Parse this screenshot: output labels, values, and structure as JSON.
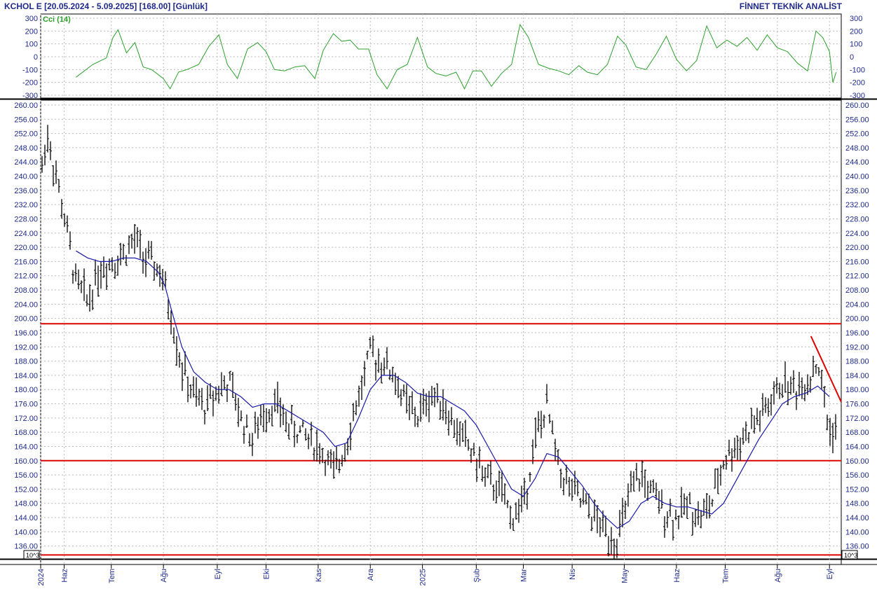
{
  "header": {
    "instrument": "KCHOL E",
    "range": "[20.05.2024 - 5.09.2025]",
    "last": "[168.00]",
    "period": "[Günlük]",
    "brand": "FİNNET TEKNİK ANALİST"
  },
  "colors": {
    "price_bars": "#000000",
    "moving_average": "#1a1aa8",
    "cci_line": "#2ca02c",
    "support_resistance": "#dd0000",
    "axis_text": "#1f2a8a",
    "grid": "#bbbbbb"
  },
  "chart_data": [
    {
      "type": "line",
      "title": "Cci (14)",
      "ylim": [
        -300,
        300
      ],
      "yticks": [
        300,
        200,
        100,
        0,
        -100,
        -200,
        -300
      ],
      "x_dates": [
        "2024-06-10",
        "2024-06-20",
        "2024-06-28",
        "2024-07-02",
        "2024-07-05",
        "2024-07-10",
        "2024-07-15",
        "2024-07-20",
        "2024-07-25",
        "2024-08-01",
        "2024-08-05",
        "2024-08-10",
        "2024-08-15",
        "2024-08-22",
        "2024-08-28",
        "2024-09-03",
        "2024-09-08",
        "2024-09-14",
        "2024-09-20",
        "2024-09-26",
        "2024-10-01",
        "2024-10-06",
        "2024-10-12",
        "2024-10-18",
        "2024-10-24",
        "2024-10-30",
        "2024-11-04",
        "2024-11-10",
        "2024-11-15",
        "2024-11-20",
        "2024-11-25",
        "2024-12-01",
        "2024-12-06",
        "2024-12-12",
        "2024-12-18",
        "2024-12-24",
        "2024-12-30",
        "2025-01-05",
        "2025-01-10",
        "2025-01-16",
        "2025-01-22",
        "2025-01-27",
        "2025-02-01",
        "2025-02-06",
        "2025-02-12",
        "2025-02-18",
        "2025-02-24",
        "2025-03-01",
        "2025-03-06",
        "2025-03-12",
        "2025-03-18",
        "2025-03-24",
        "2025-03-30",
        "2025-04-05",
        "2025-04-10",
        "2025-04-16",
        "2025-04-22",
        "2025-04-28",
        "2025-05-03",
        "2025-05-09",
        "2025-05-15",
        "2025-05-21",
        "2025-05-27",
        "2025-06-02",
        "2025-06-08",
        "2025-06-14",
        "2025-06-20",
        "2025-06-26",
        "2025-07-02",
        "2025-07-08",
        "2025-07-14",
        "2025-07-20",
        "2025-07-26",
        "2025-08-01",
        "2025-08-07",
        "2025-08-13",
        "2025-08-19",
        "2025-08-24",
        "2025-08-28",
        "2025-09-01",
        "2025-09-03",
        "2025-09-05"
      ],
      "values": [
        -160,
        -60,
        -10,
        150,
        210,
        30,
        110,
        -80,
        -100,
        -170,
        -250,
        -120,
        -100,
        -60,
        80,
        170,
        -60,
        -170,
        60,
        110,
        40,
        -100,
        -110,
        -80,
        -70,
        -170,
        50,
        180,
        120,
        130,
        60,
        60,
        -140,
        -250,
        -100,
        -60,
        150,
        -80,
        -130,
        -150,
        -120,
        -250,
        -110,
        -110,
        -230,
        -130,
        -60,
        250,
        150,
        -60,
        -90,
        -110,
        -140,
        -70,
        -120,
        -140,
        -60,
        160,
        90,
        -80,
        -100,
        20,
        160,
        -20,
        -110,
        -30,
        240,
        70,
        130,
        80,
        150,
        50,
        170,
        70,
        40,
        -50,
        -110,
        200,
        150,
        40,
        -200,
        -120
      ]
    },
    {
      "type": "line",
      "title": "",
      "ylim": [
        132,
        260
      ],
      "yticks": [
        260,
        256,
        252,
        248,
        244,
        240,
        236,
        232,
        228,
        224,
        220,
        216,
        212,
        208,
        204,
        200,
        196,
        192,
        188,
        184,
        180,
        176,
        172,
        168,
        164,
        160,
        156,
        152,
        148,
        144,
        140,
        136
      ],
      "unit_label": "10^3",
      "x_dates": [
        "2024-05-20",
        "2024-05-24",
        "2024-05-30",
        "2024-06-04",
        "2024-06-10",
        "2024-06-17",
        "2024-06-24",
        "2024-07-01",
        "2024-07-08",
        "2024-07-15",
        "2024-07-22",
        "2024-07-29",
        "2024-08-02",
        "2024-08-06",
        "2024-08-12",
        "2024-08-19",
        "2024-08-26",
        "2024-09-02",
        "2024-09-09",
        "2024-09-16",
        "2024-09-23",
        "2024-09-30",
        "2024-10-07",
        "2024-10-14",
        "2024-10-21",
        "2024-10-28",
        "2024-11-04",
        "2024-11-11",
        "2024-11-18",
        "2024-11-25",
        "2024-12-02",
        "2024-12-09",
        "2024-12-16",
        "2024-12-23",
        "2024-12-30",
        "2025-01-06",
        "2025-01-13",
        "2025-01-20",
        "2025-01-27",
        "2025-02-03",
        "2025-02-10",
        "2025-02-17",
        "2025-02-24",
        "2025-03-03",
        "2025-03-10",
        "2025-03-17",
        "2025-03-24",
        "2025-03-31",
        "2025-04-07",
        "2025-04-14",
        "2025-04-21",
        "2025-04-28",
        "2025-05-05",
        "2025-05-12",
        "2025-05-19",
        "2025-05-26",
        "2025-06-02",
        "2025-06-09",
        "2025-06-16",
        "2025-06-23",
        "2025-06-30",
        "2025-07-07",
        "2025-07-14",
        "2025-07-21",
        "2025-07-28",
        "2025-08-04",
        "2025-08-11",
        "2025-08-18",
        "2025-08-25",
        "2025-09-01",
        "2025-09-05"
      ],
      "price_close": [
        240,
        252,
        238,
        226,
        210,
        205,
        214,
        216,
        218,
        222,
        216,
        214,
        208,
        200,
        186,
        178,
        175,
        180,
        182,
        172,
        166,
        174,
        176,
        170,
        168,
        166,
        162,
        156,
        166,
        178,
        190,
        188,
        184,
        176,
        172,
        178,
        178,
        170,
        166,
        160,
        154,
        152,
        144,
        148,
        166,
        175,
        158,
        152,
        148,
        144,
        140,
        138,
        150,
        156,
        150,
        146,
        144,
        148,
        144,
        148,
        160,
        164,
        168,
        172,
        176,
        182,
        180,
        182,
        188,
        168,
        170
      ],
      "moving_average": [
        null,
        null,
        null,
        null,
        219,
        217,
        216,
        216,
        217,
        217,
        216,
        213,
        209,
        202,
        192,
        185,
        182,
        180,
        180,
        178,
        175,
        176,
        176,
        174,
        172,
        170,
        168,
        164,
        165,
        172,
        180,
        184,
        184,
        182,
        179,
        178,
        178,
        176,
        174,
        170,
        164,
        158,
        152,
        150,
        155,
        162,
        161,
        157,
        153,
        148,
        144,
        141,
        143,
        148,
        150,
        148,
        147,
        147,
        146,
        145,
        148,
        154,
        160,
        166,
        171,
        176,
        178,
        179,
        181,
        178,
        null
      ],
      "horizontal_levels": [
        198.5,
        160.0,
        133.5
      ],
      "trendline": [
        [
          "2025-08-21",
          195.0
        ],
        [
          "2025-09-08",
          176.5
        ]
      ]
    }
  ],
  "x_axis": {
    "labels": [
      "2024",
      "Haz",
      "Tem",
      "Ağu",
      "Eyl",
      "Eki",
      "Kas",
      "Ara",
      "2025",
      "Şub",
      "Mar",
      "Nis",
      "May",
      "Haz",
      "Tem",
      "Ağu",
      "Eyl"
    ],
    "label_dates": [
      "2024-05-20",
      "2024-06-03",
      "2024-07-01",
      "2024-08-01",
      "2024-09-02",
      "2024-10-01",
      "2024-11-01",
      "2024-12-02",
      "2025-01-02",
      "2025-02-03",
      "2025-03-03",
      "2025-04-01",
      "2025-05-02",
      "2025-06-02",
      "2025-07-01",
      "2025-08-01",
      "2025-09-01"
    ]
  }
}
